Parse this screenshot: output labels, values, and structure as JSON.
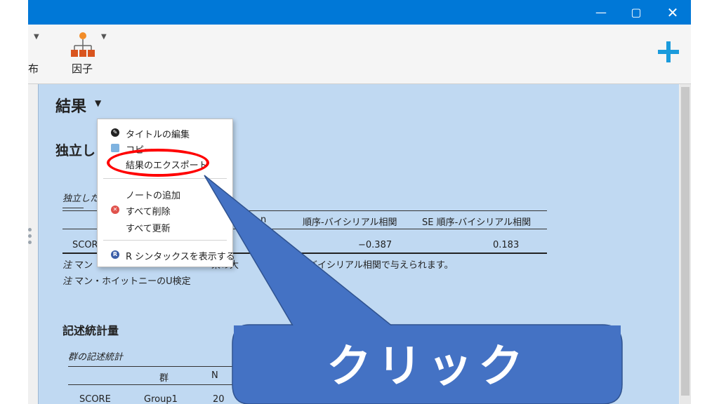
{
  "window": {
    "minimize_icon": "minimize-icon",
    "maximize_icon": "maximize-icon",
    "close_icon": "close-icon",
    "colors": {
      "titlebar": "#0078d7",
      "content_bg": "#c0d9f2",
      "plus": "#1a9bdc"
    }
  },
  "ribbon": {
    "partial_label": "布",
    "factor_label": "因子",
    "factor_icon": "factor-hierarchy-icon",
    "add_icon": "plus-icon"
  },
  "results": {
    "title": "結果",
    "section1_title_partial": "独立し",
    "table1_caption_partial": "独立した",
    "col_partial": "n",
    "col_rank_biserial": "順序-バイシリアル相関",
    "col_se_rank_biserial": "SE 順序-バイシリアル相関",
    "row_label_partial": "SCORE",
    "row_value1": "−0.387",
    "row_value2": "0.183",
    "note1_prefix": "注",
    "note1_start": "マン",
    "note1_mid": "果の大",
    "note1_end": "バイシリアル相関で与えられます。",
    "note2_prefix": "注",
    "note2_text": "マン・ホイットニーのU検定",
    "section2_title": "記述統計量",
    "table2_caption": "群の記述統計",
    "table2_col_group": "群",
    "table2_col_n": "N",
    "table2_row_label": "SCORE",
    "table2_row_group": "Group1",
    "table2_row_n": "20"
  },
  "context_menu": {
    "items": [
      {
        "label": "タイトルの編集",
        "icon": "pencil-icon"
      },
      {
        "label": "コピー",
        "icon": "copy-icon"
      },
      {
        "label": "結果のエクスポート",
        "icon": ""
      },
      {
        "label": "ノートの追加",
        "icon": ""
      },
      {
        "label": "すべて削除",
        "icon": "delete-icon"
      },
      {
        "label": "すべて更新",
        "icon": ""
      },
      {
        "label": "R シンタックスを表示する",
        "icon": "r-icon"
      }
    ]
  },
  "callout": {
    "text": "クリック",
    "color": "#4472c4"
  }
}
